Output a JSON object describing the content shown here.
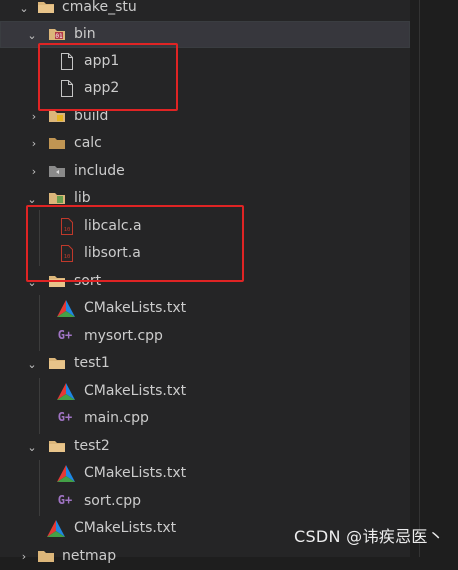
{
  "tree": {
    "root_label": "cmake_stu",
    "bin": {
      "label": "bin",
      "files": [
        "app1",
        "app2"
      ]
    },
    "build_label": "build",
    "calc_label": "calc",
    "include_label": "include",
    "lib": {
      "label": "lib",
      "files": [
        "libcalc.a",
        "libsort.a"
      ]
    },
    "sort": {
      "label": "sort",
      "files": [
        "CMakeLists.txt",
        "mysort.cpp"
      ]
    },
    "test1": {
      "label": "test1",
      "files": [
        "CMakeLists.txt",
        "main.cpp"
      ]
    },
    "test2": {
      "label": "test2",
      "files": [
        "CMakeLists.txt",
        "sort.cpp"
      ]
    },
    "root_file": "CMakeLists.txt",
    "next_label": "netmap"
  },
  "watermark": "CSDN @讳疾忌医丶",
  "colors": {
    "folder": "#dcb67a",
    "highlight_box": "#e02424",
    "cpp_icon": "#a074c4",
    "lib_icon": "#c0392b"
  }
}
